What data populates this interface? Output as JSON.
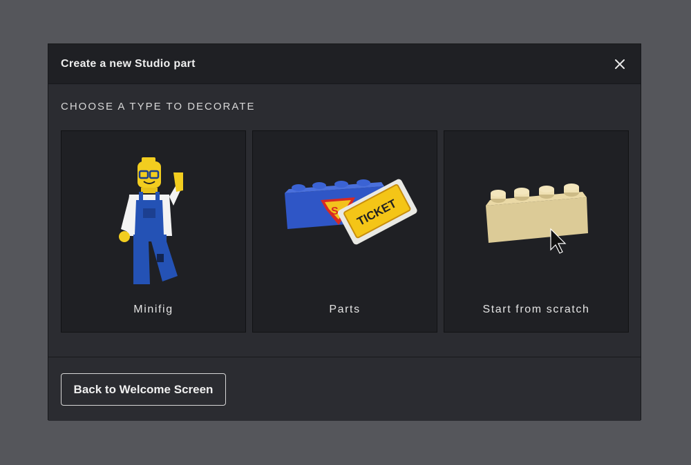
{
  "dialog": {
    "title": "Create a new Studio part",
    "close_icon": "close-icon",
    "heading": "CHOOSE A TYPE TO DECORATE",
    "options": [
      {
        "label": "Minifig",
        "icon": "minifig-icon"
      },
      {
        "label": "Parts",
        "icon": "decorated-parts-icon"
      },
      {
        "label": "Start from scratch",
        "icon": "plain-brick-icon"
      }
    ],
    "back_label": "Back to Welcome Screen"
  },
  "colors": {
    "background": "#55565b",
    "dialog": "#2b2c31",
    "header": "#1f2024",
    "card": "#1f2024",
    "text": "#e4e4e4"
  }
}
